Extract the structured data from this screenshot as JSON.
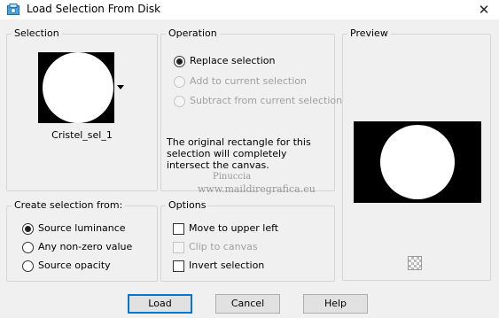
{
  "window": {
    "title": "Load Selection From Disk",
    "close_icon": "close-icon",
    "app_icon": "selection-app-icon"
  },
  "selection_group": {
    "label": "Selection",
    "file_name": "Cristel_sel_1"
  },
  "operation_group": {
    "label": "Operation",
    "options": [
      {
        "label": "Replace selection",
        "checked": true,
        "enabled": true
      },
      {
        "label": "Add to current selection",
        "checked": false,
        "enabled": false
      },
      {
        "label": "Subtract from current selection",
        "checked": false,
        "enabled": false
      }
    ],
    "note": "The original rectangle for this selection will completely intersect the canvas."
  },
  "preview_group": {
    "label": "Preview"
  },
  "create_from_group": {
    "label": "Create selection from:",
    "options": [
      {
        "label": "Source luminance",
        "checked": true
      },
      {
        "label": "Any non-zero value",
        "checked": false
      },
      {
        "label": "Source opacity",
        "checked": false
      }
    ]
  },
  "options_group": {
    "label": "Options",
    "checks": [
      {
        "label": "Move to upper left",
        "checked": false,
        "enabled": true
      },
      {
        "label": "Clip to canvas",
        "checked": false,
        "enabled": false
      },
      {
        "label": "Invert selection",
        "checked": false,
        "enabled": true
      }
    ]
  },
  "watermark": {
    "line1": "Pinuccia",
    "line2": "www.maildiregrafica.eu"
  },
  "buttons": {
    "load": "Load",
    "cancel": "Cancel",
    "help": "Help"
  }
}
